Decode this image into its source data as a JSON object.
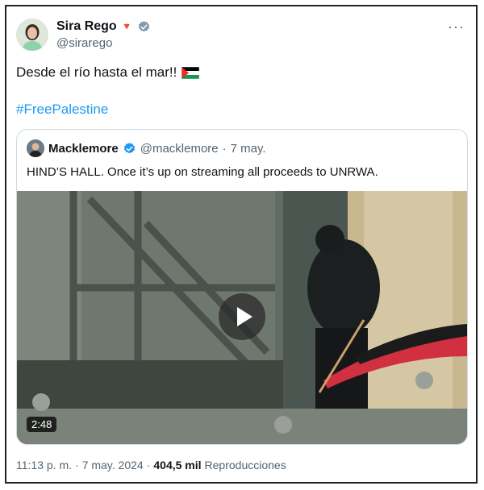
{
  "author": {
    "display_name": "Sira Rego",
    "handle": "@sirarego",
    "emoji_badge": "🔻",
    "verified_color": "#829aab"
  },
  "more_label": "···",
  "tweet": {
    "text": "Desde el río hasta el mar!!",
    "hashtag": "#FreePalestine"
  },
  "quoted": {
    "display_name": "Macklemore",
    "handle": "@macklemore",
    "separator": "·",
    "date": "7 may.",
    "text": "HIND’S HALL. Once it’s up on streaming all proceeds to UNRWA.",
    "verified_color": "#1d9bf0",
    "video_duration": "2:48"
  },
  "footer": {
    "time": "11:13 p. m.",
    "separator": "·",
    "date": "7 may. 2024",
    "separator2": "·",
    "views": "404,5 mil",
    "views_label": "Reproducciones"
  }
}
